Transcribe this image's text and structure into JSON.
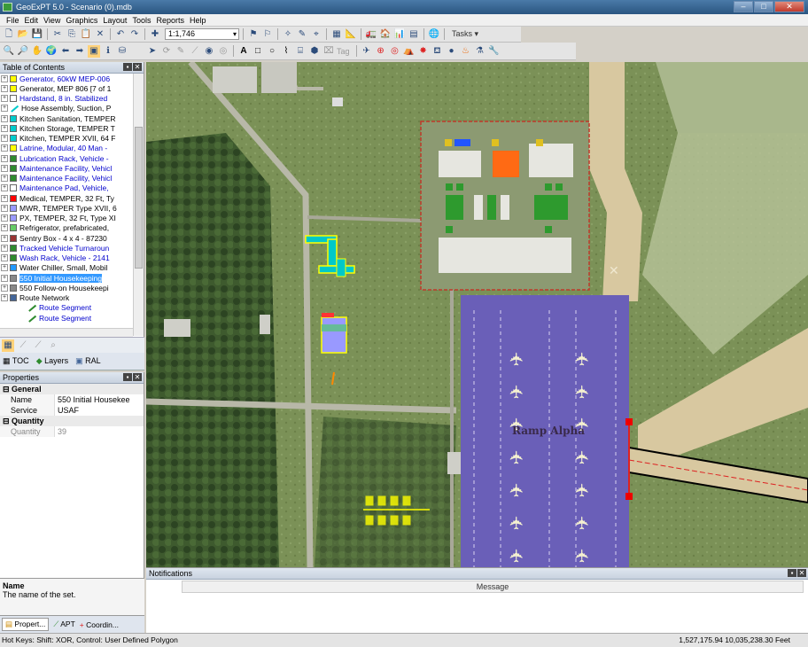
{
  "window": {
    "title": "GeoExPT 5.0 - Scenario (0).mdb"
  },
  "menu": [
    "File",
    "Edit",
    "View",
    "Graphics",
    "Layout",
    "Tools",
    "Reports",
    "Help"
  ],
  "toolbar": {
    "scale_value": "1:1,746",
    "tasks_label": "Tasks",
    "tag_label": "Tag"
  },
  "toc": {
    "title": "Table of Contents",
    "items": [
      {
        "label": "Generator, 60kW MEP-006",
        "color": "#ffff00",
        "blue": true
      },
      {
        "label": "Generator, MEP 806 [7 of 1",
        "color": "#ffff00",
        "blue": false
      },
      {
        "label": "Hardstand, 8 in. Stabilized",
        "color": "#ffffff",
        "blue": true
      },
      {
        "label": "Hose Assembly, Suction, P",
        "color": "#00cccc",
        "blue": false,
        "line": true
      },
      {
        "label": "Kitchen Sanitation, TEMPER",
        "color": "#00cccc",
        "blue": false
      },
      {
        "label": "Kitchen Storage, TEMPER T",
        "color": "#00cccc",
        "blue": false
      },
      {
        "label": "Kitchen, TEMPER XVII, 64 F",
        "color": "#00cccc",
        "blue": false
      },
      {
        "label": "Latrine, Modular, 40 Man -",
        "color": "#ffff00",
        "blue": true
      },
      {
        "label": "Lubrication Rack, Vehicle -",
        "color": "#2e8b2e",
        "blue": true
      },
      {
        "label": "Maintenance Facility, Vehicl",
        "color": "#2e8b2e",
        "blue": true
      },
      {
        "label": "Maintenance Facility, Vehicl",
        "color": "#2e8b2e",
        "blue": true
      },
      {
        "label": "Maintenance Pad, Vehicle,",
        "color": "#ffffff",
        "blue": true
      },
      {
        "label": "Medical, TEMPER, 32 Ft, Ty",
        "color": "#ff0000",
        "blue": false
      },
      {
        "label": "MWR, TEMPER Type XVII, 6",
        "color": "#9999ff",
        "blue": false
      },
      {
        "label": "PX, TEMPER, 32 Ft, Type XI",
        "color": "#9999ff",
        "blue": false
      },
      {
        "label": "Refrigerator, prefabricated,",
        "color": "#66cc66",
        "blue": false
      },
      {
        "label": "Sentry Box - 4 x 4 - 87230",
        "color": "#993333",
        "blue": false
      },
      {
        "label": "Tracked Vehicle Turnaroun",
        "color": "#2e8b2e",
        "blue": true
      },
      {
        "label": "Wash Rack, Vehicle - 2141",
        "color": "#2e8b2e",
        "blue": true
      },
      {
        "label": "Water Chiller, Small, Mobil",
        "color": "#2299ff",
        "blue": false
      },
      {
        "label": "550 Initial Housekeeping",
        "color": "#888888",
        "blue": false,
        "selected": true
      },
      {
        "label": "550 Follow-on Housekeepi",
        "color": "#888888",
        "blue": false
      },
      {
        "label": "Route Network",
        "color": "#446699",
        "blue": false
      },
      {
        "label": "Route Segment",
        "color": "#2e8b2e",
        "blue": true,
        "indent": true
      },
      {
        "label": "Route Segment",
        "color": "#2e8b2e",
        "blue": true,
        "indent": true
      }
    ],
    "tabs": [
      "TOC",
      "Layers",
      "RAL"
    ]
  },
  "properties": {
    "title": "Properties",
    "groups": [
      {
        "name": "General",
        "rows": [
          {
            "key": "Name",
            "value": "550 Initial Housekee"
          },
          {
            "key": "Service",
            "value": "USAF"
          }
        ]
      },
      {
        "name": "Quantity",
        "rows": [
          {
            "key": "Quantity",
            "value": "39"
          }
        ]
      }
    ],
    "desc_title": "Name",
    "desc_text": "The name of the set."
  },
  "bottom_tabs": [
    "Propert...",
    "APT",
    "Coordin..."
  ],
  "map": {
    "label": "Ramp Alpha"
  },
  "notifications": {
    "title": "Notifications",
    "column": "Message"
  },
  "status": {
    "hotkeys": "Hot Keys: Shift: XOR, Control: User Defined Polygon",
    "coords": "1,527,175.94 10,035,238.30 Feet"
  },
  "colors": {
    "ramp": "#6a5fb8",
    "runway": "#d8c8a0",
    "grass": "#6e8a4a",
    "selection": "#3399ff"
  }
}
